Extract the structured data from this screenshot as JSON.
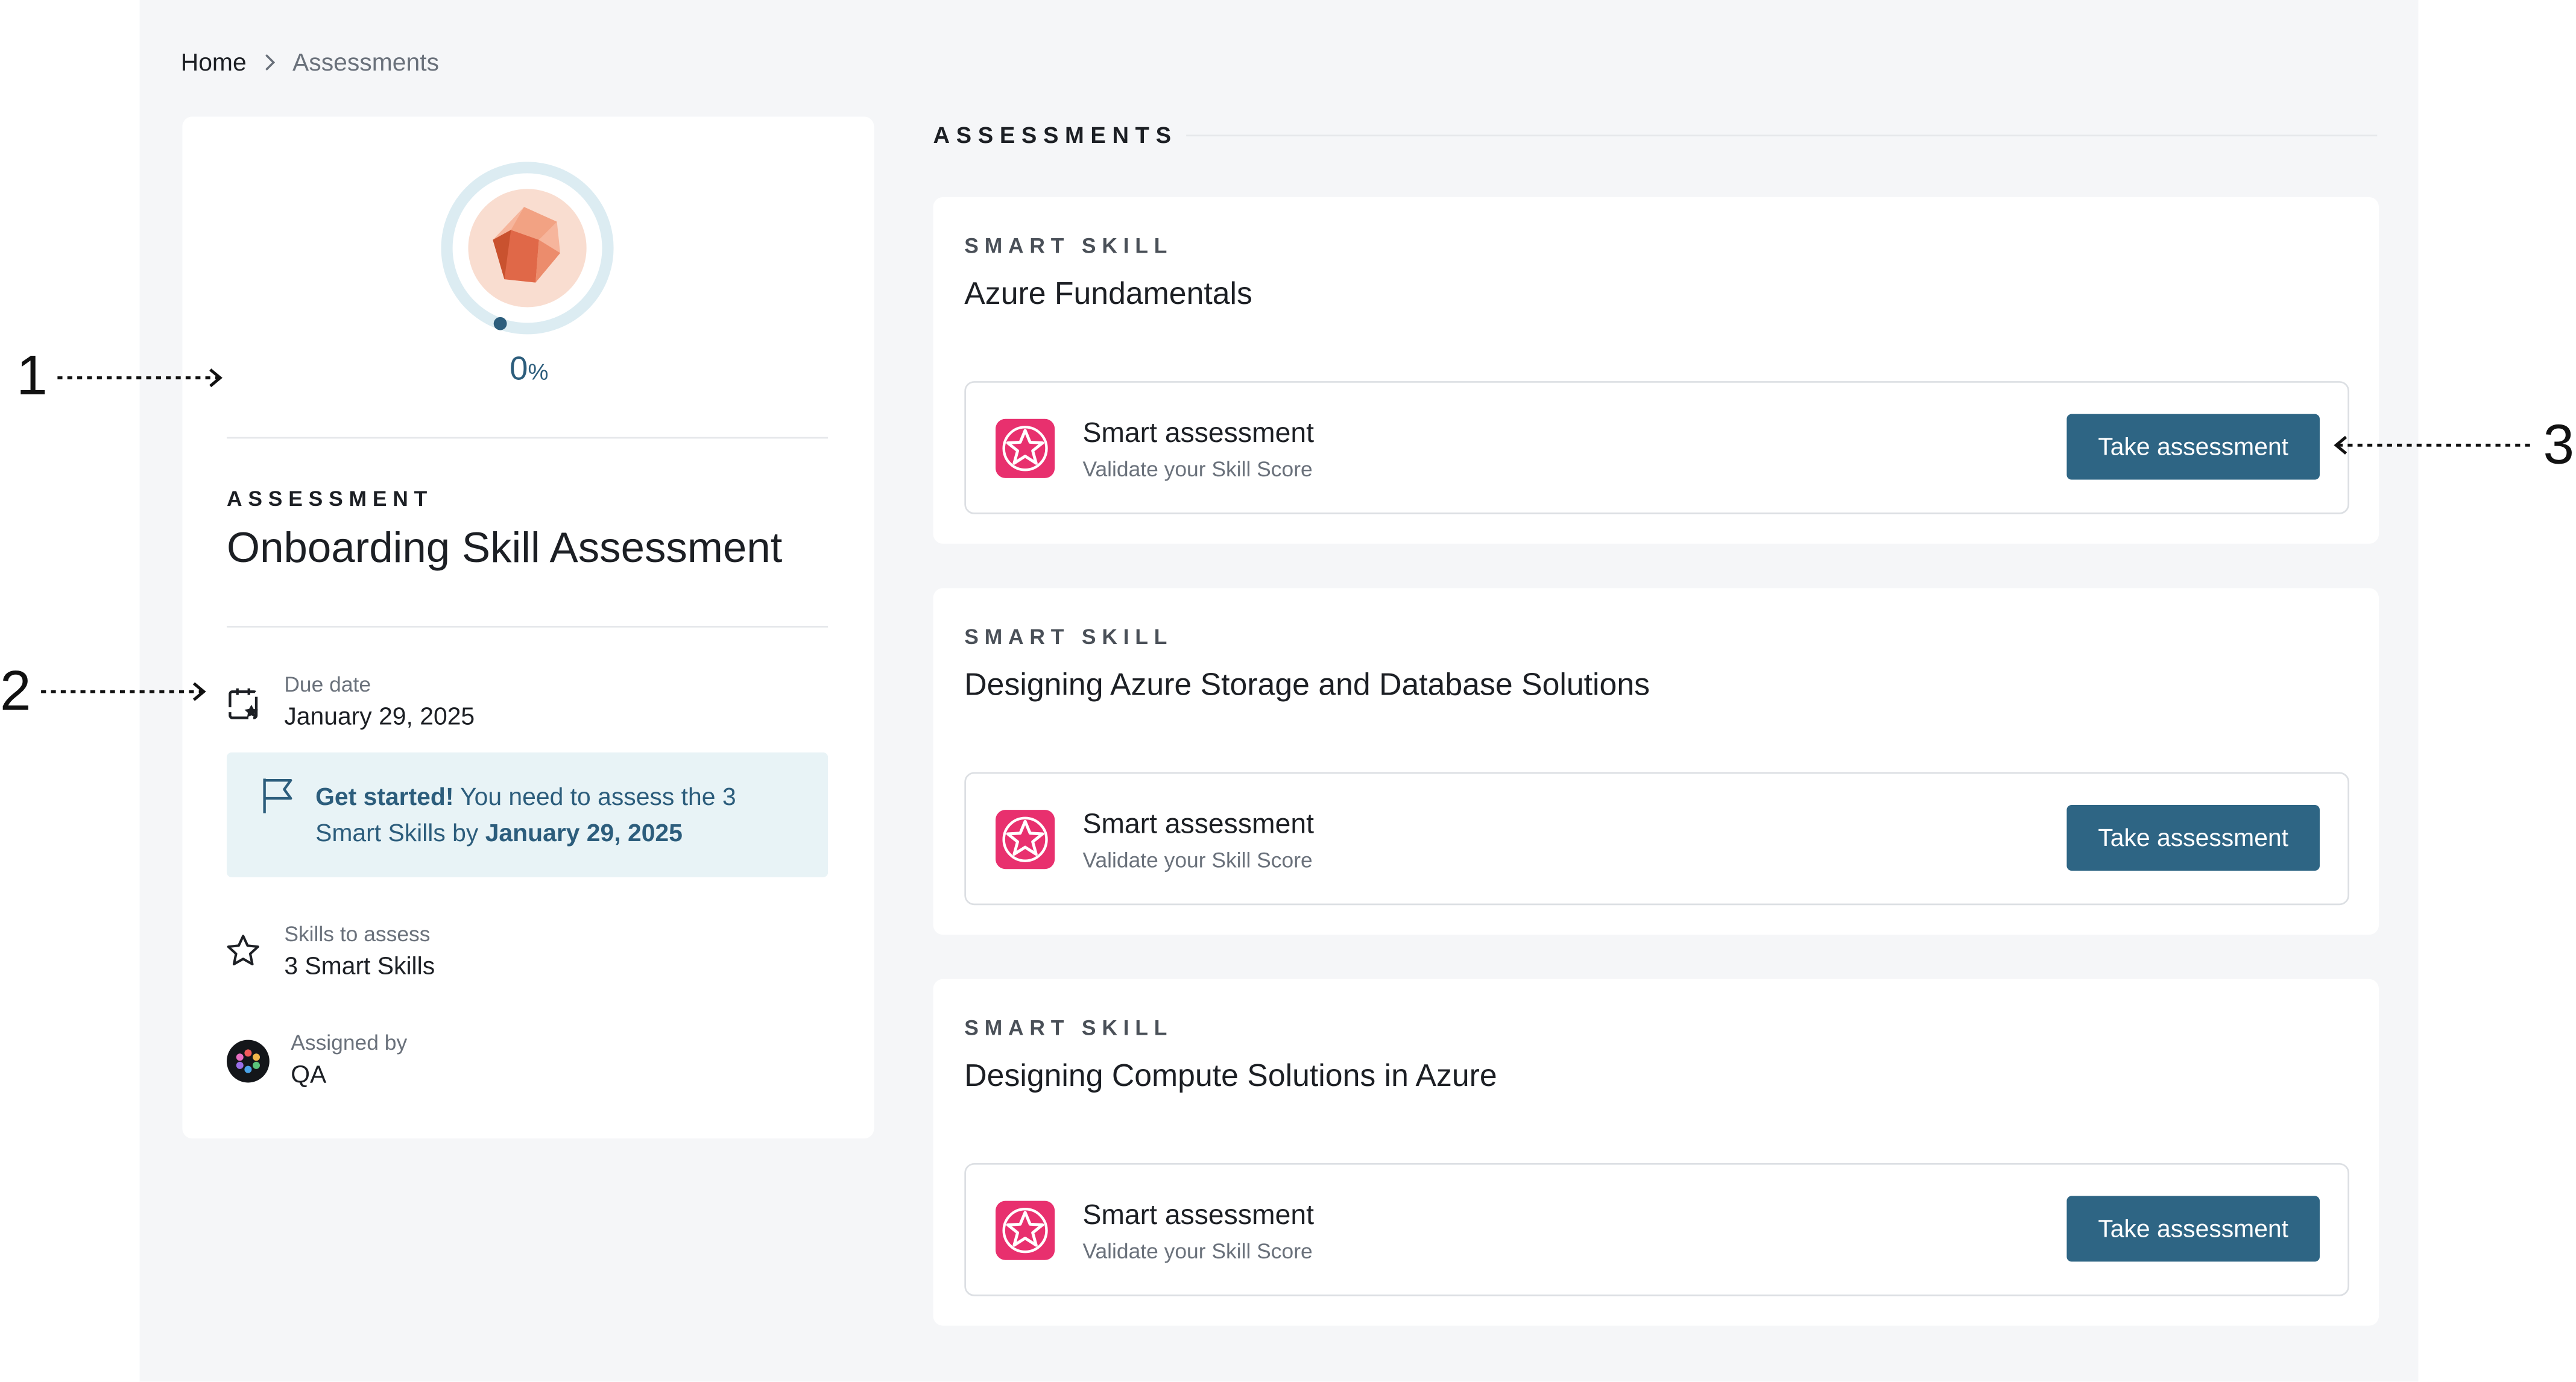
{
  "breadcrumb": {
    "home": "Home",
    "current": "Assessments"
  },
  "overview": {
    "progress_value": "0",
    "progress_unit": "%",
    "eyebrow": "ASSESSMENT",
    "title": "Onboarding Skill Assessment",
    "due_label": "Due date",
    "due_value": "January 29, 2025",
    "notice": {
      "lead": "Get started!",
      "text_1": " You need to assess the 3 Smart Skills by ",
      "date": "January 29, 2025"
    },
    "skills_label": "Skills to assess",
    "skills_value": "3 Smart Skills",
    "assigned_label": "Assigned by",
    "assigned_value": "QA"
  },
  "assessments": {
    "section_title": "ASSESSMENTS",
    "cards": [
      {
        "eyebrow": "SMART SKILL",
        "title": "Azure Fundamentals",
        "item_label": "Smart assessment",
        "item_sub": "Validate your Skill Score",
        "button": "Take assessment"
      },
      {
        "eyebrow": "SMART SKILL",
        "title": "Designing Azure Storage and Database Solutions",
        "item_label": "Smart assessment",
        "item_sub": "Validate your Skill Score",
        "button": "Take assessment"
      },
      {
        "eyebrow": "SMART SKILL",
        "title": "Designing Compute Solutions in Azure",
        "item_label": "Smart assessment",
        "item_sub": "Validate your Skill Score",
        "button": "Take assessment"
      }
    ]
  },
  "callouts": {
    "one": "1",
    "two": "2",
    "three": "3"
  },
  "colors": {
    "accent": "#2e6584",
    "skill_icon": "#e8306e",
    "notice_bg": "#e8f3f6"
  },
  "icons": [
    "chevron-right-icon",
    "skill-gem-icon",
    "calendar-star-icon",
    "flag-icon",
    "star-outline-icon",
    "qa-avatar-icon",
    "star-badge-icon"
  ]
}
